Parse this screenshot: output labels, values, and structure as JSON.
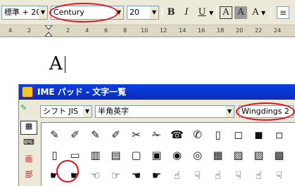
{
  "toolbar": {
    "style_value": "標準 + 20",
    "font_value": "Century",
    "size_value": "20",
    "bold": "B",
    "italic": "I",
    "underline": "U",
    "char_border": "A",
    "char_shade": "A",
    "highlight": "A"
  },
  "ruler": {
    "ticks": [
      "4",
      "2",
      "2",
      "4",
      "6",
      "8",
      "10",
      "12",
      "14",
      "16",
      "18",
      "20",
      "22",
      "24"
    ]
  },
  "document": {
    "text": "A"
  },
  "ime": {
    "title": "IME パッド - 文字一覧",
    "charset": "シフト JIS",
    "range": "半角英字",
    "font": "Wingdings 2",
    "rows": [
      [
        "✎",
        "✐",
        "✎",
        "✐",
        "✂",
        "✁",
        "☎",
        "✆",
        "▯",
        "◻",
        "◼",
        "◽"
      ],
      [
        "▯",
        "▭",
        "▥",
        "▤",
        "▢",
        "▣",
        "◉",
        "◎",
        "▦",
        "▧",
        "▨",
        "▩"
      ],
      [
        "☛",
        "☛",
        "☜",
        "☞",
        "☚",
        "☛",
        "☝",
        "☟",
        "☝",
        "☟",
        "☝",
        "☟"
      ]
    ]
  }
}
